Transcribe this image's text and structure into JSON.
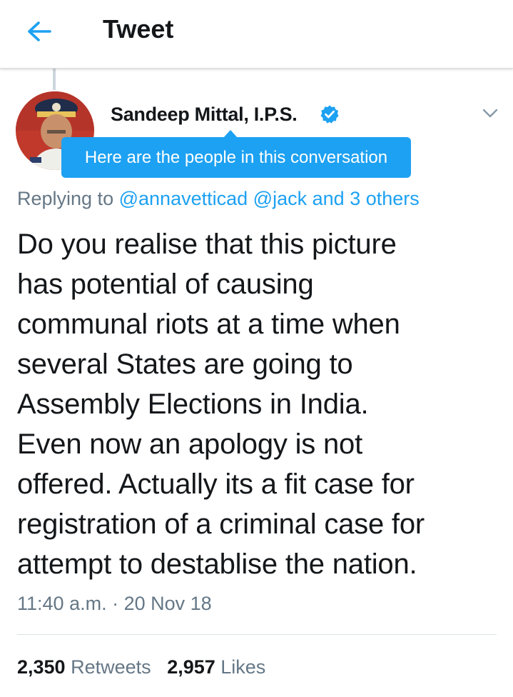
{
  "header": {
    "title": "Tweet",
    "back_icon": "arrow-left-icon"
  },
  "tweet": {
    "author_name": "Sandeep Mittal, I.P.S.",
    "verified_icon": "verified-badge-icon",
    "menu_icon": "chevron-down-icon",
    "tooltip": "Here are the people in this conversation",
    "replying_prefix": "Replying to",
    "replying_mention_1": "@annavetticad",
    "replying_mention_2": "@jack",
    "replying_and": "and",
    "replying_others": "3 others",
    "text_lines": [
      "Do you realise that this picture",
      "has potential of causing",
      "communal riots at a time when",
      "several States are going to",
      "Assembly Elections in India.",
      "Even now an apology is not",
      "offered. Actually its a fit case for",
      "registration of a criminal case for",
      "attempt to destablise the nation."
    ],
    "timestamp": "11:40 a.m. · 20 Nov 18",
    "retweets_count": "2,350",
    "retweets_label": "Retweets",
    "likes_count": "2,957",
    "likes_label": "Likes"
  },
  "colors": {
    "accent": "#1da1f2",
    "secondary_text": "#657786",
    "primary_text": "#14171a"
  }
}
